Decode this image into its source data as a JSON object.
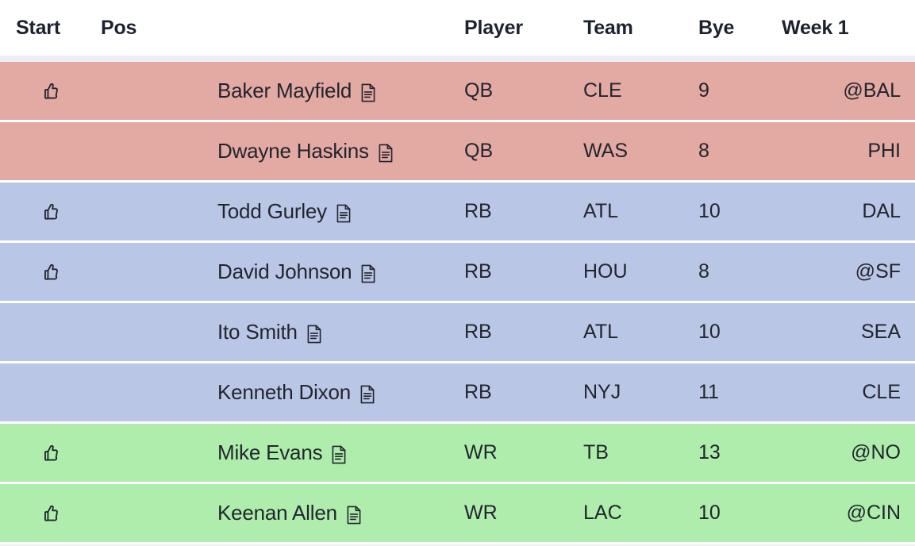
{
  "table": {
    "columns": {
      "start": "Start",
      "pos": "Pos",
      "player": "Player",
      "team": "Team",
      "bye": "Bye",
      "week": "Week 1"
    },
    "colors": {
      "qb_row": "#e3a9a3",
      "rb_row": "#bac6e6",
      "wr_row": "#aeedab",
      "header_bg": "#ffffff",
      "separator": "#ffffff",
      "gutter": "#eceef3",
      "text": "#22252e"
    },
    "icons": {
      "start": "thumbs-up-icon",
      "note": "note-document-icon"
    },
    "rows": [
      {
        "name": "Baker Mayfield",
        "pos": "QB",
        "team": "CLE",
        "bye": "9",
        "week1": "@BAL",
        "starter": true,
        "group": "qb"
      },
      {
        "name": "Dwayne Haskins",
        "pos": "QB",
        "team": "WAS",
        "bye": "8",
        "week1": "PHI",
        "starter": false,
        "group": "qb"
      },
      {
        "name": "Todd Gurley",
        "pos": "RB",
        "team": "ATL",
        "bye": "10",
        "week1": "DAL",
        "starter": true,
        "group": "rb"
      },
      {
        "name": "David Johnson",
        "pos": "RB",
        "team": "HOU",
        "bye": "8",
        "week1": "@SF",
        "starter": true,
        "group": "rb"
      },
      {
        "name": "Ito Smith",
        "pos": "RB",
        "team": "ATL",
        "bye": "10",
        "week1": "SEA",
        "starter": false,
        "group": "rb"
      },
      {
        "name": "Kenneth Dixon",
        "pos": "RB",
        "team": "NYJ",
        "bye": "11",
        "week1": "CLE",
        "starter": false,
        "group": "rb"
      },
      {
        "name": "Mike Evans",
        "pos": "WR",
        "team": "TB",
        "bye": "13",
        "week1": "@NO",
        "starter": true,
        "group": "wr"
      },
      {
        "name": "Keenan Allen",
        "pos": "WR",
        "team": "LAC",
        "bye": "10",
        "week1": "@CIN",
        "starter": true,
        "group": "wr"
      }
    ]
  }
}
